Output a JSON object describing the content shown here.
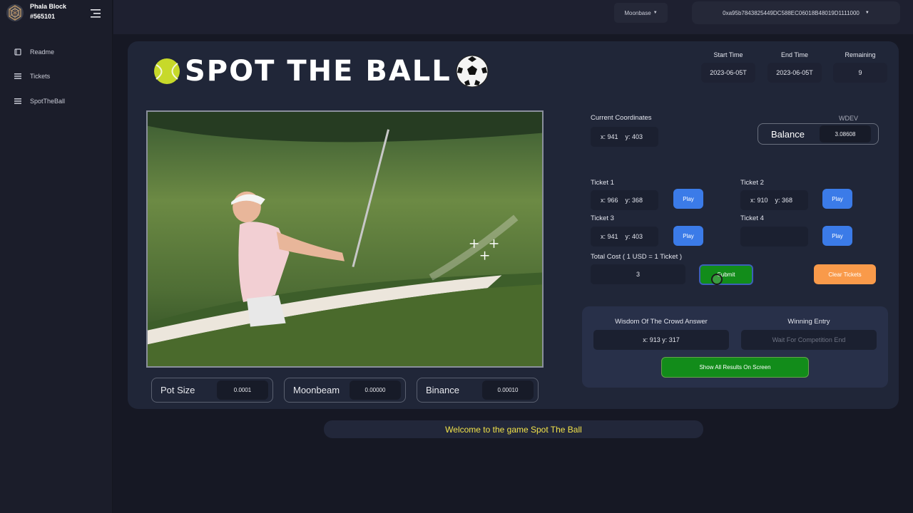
{
  "sidebar": {
    "brand_name": "Phala Block",
    "block_number": "#565101",
    "items": [
      {
        "label": "Readme",
        "icon": "book-icon"
      },
      {
        "label": "Tickets",
        "icon": "list-icon"
      },
      {
        "label": "SpotTheBall",
        "icon": "list-icon"
      }
    ]
  },
  "topbar": {
    "network": "Moonbase",
    "wallet_address": "0xa95b7843825449DC588EC06018B48019D1111000"
  },
  "game": {
    "title": "SPOT THE BALL",
    "start_time_label": "Start Time",
    "start_time": "2023-06-05T",
    "end_time_label": "End Time",
    "end_time": "2023-06-05T",
    "remaining_label": "Remaining",
    "remaining": "9"
  },
  "coords": {
    "label": "Current Coordinates",
    "x": "x:  941",
    "y": "y:  403"
  },
  "balance": {
    "currency": "WDEV",
    "label": "Balance",
    "value": "3.08608"
  },
  "tickets": [
    {
      "label": "Ticket 1",
      "x": "x:  966",
      "y": "y:  368",
      "play": "Play"
    },
    {
      "label": "Ticket 2",
      "x": "x:  910",
      "y": "y:  368",
      "play": "Play"
    },
    {
      "label": "Ticket 3",
      "x": "x:  941",
      "y": "y:  403",
      "play": "Play"
    },
    {
      "label": "Ticket 4",
      "x": "",
      "y": "",
      "play": "Play"
    }
  ],
  "cost": {
    "label": "Total Cost ( 1 USD = 1 Ticket )",
    "value": "3",
    "submit": "Submit",
    "clear": "Clear Tickets"
  },
  "results": {
    "crowd_label": "Wisdom Of The Crowd Answer",
    "crowd_value": "x: 913 y: 317",
    "winning_label": "Winning Entry",
    "winning_placeholder": "Wait For Competition End",
    "show_button": "Show All Results On Screen"
  },
  "pots": [
    {
      "label": "Pot Size",
      "value": "0.0001"
    },
    {
      "label": "Moonbeam",
      "value": "0.00000"
    },
    {
      "label": "Binance",
      "value": "0.00010"
    }
  ],
  "welcome": "Welcome to the game Spot The Ball",
  "colors": {
    "accent_blue": "#3b7be8",
    "submit_green": "#128c1a",
    "clear_orange": "#f99a4a",
    "welcome_yellow": "#f1e24a"
  }
}
